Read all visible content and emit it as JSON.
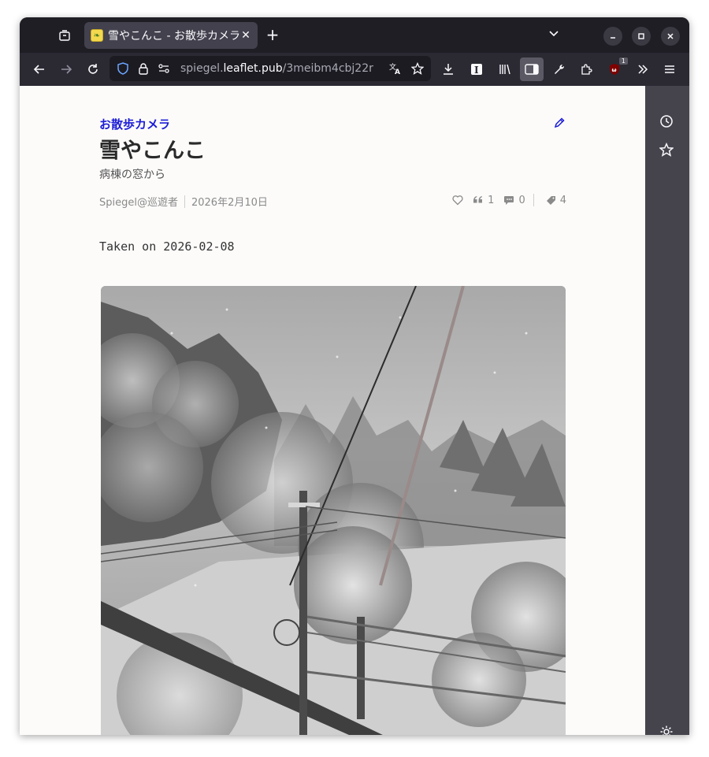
{
  "browser": {
    "tab": {
      "title": "雪やこんこ - お散歩カメラ",
      "close_label": "✕"
    },
    "new_tab_label": "+",
    "url": {
      "prefix": "spiegel.",
      "host": "leaflet.pub",
      "path": "/3meibm4cbj22r"
    },
    "extension_badge": "1"
  },
  "article": {
    "publication": "お散歩カメラ",
    "title": "雪やこんこ",
    "subtitle": "病棟の窓から",
    "author": "Spiegel@巡遊者",
    "date": "2026年2月10日",
    "quotes_count": "1",
    "comments_count": "0",
    "mentions_count": "4",
    "body": "Taken on 2026-02-08"
  },
  "colors": {
    "accent": "#1c1cd6",
    "page_bg": "#fcfbfa",
    "toolbar": "#2b2a33"
  }
}
